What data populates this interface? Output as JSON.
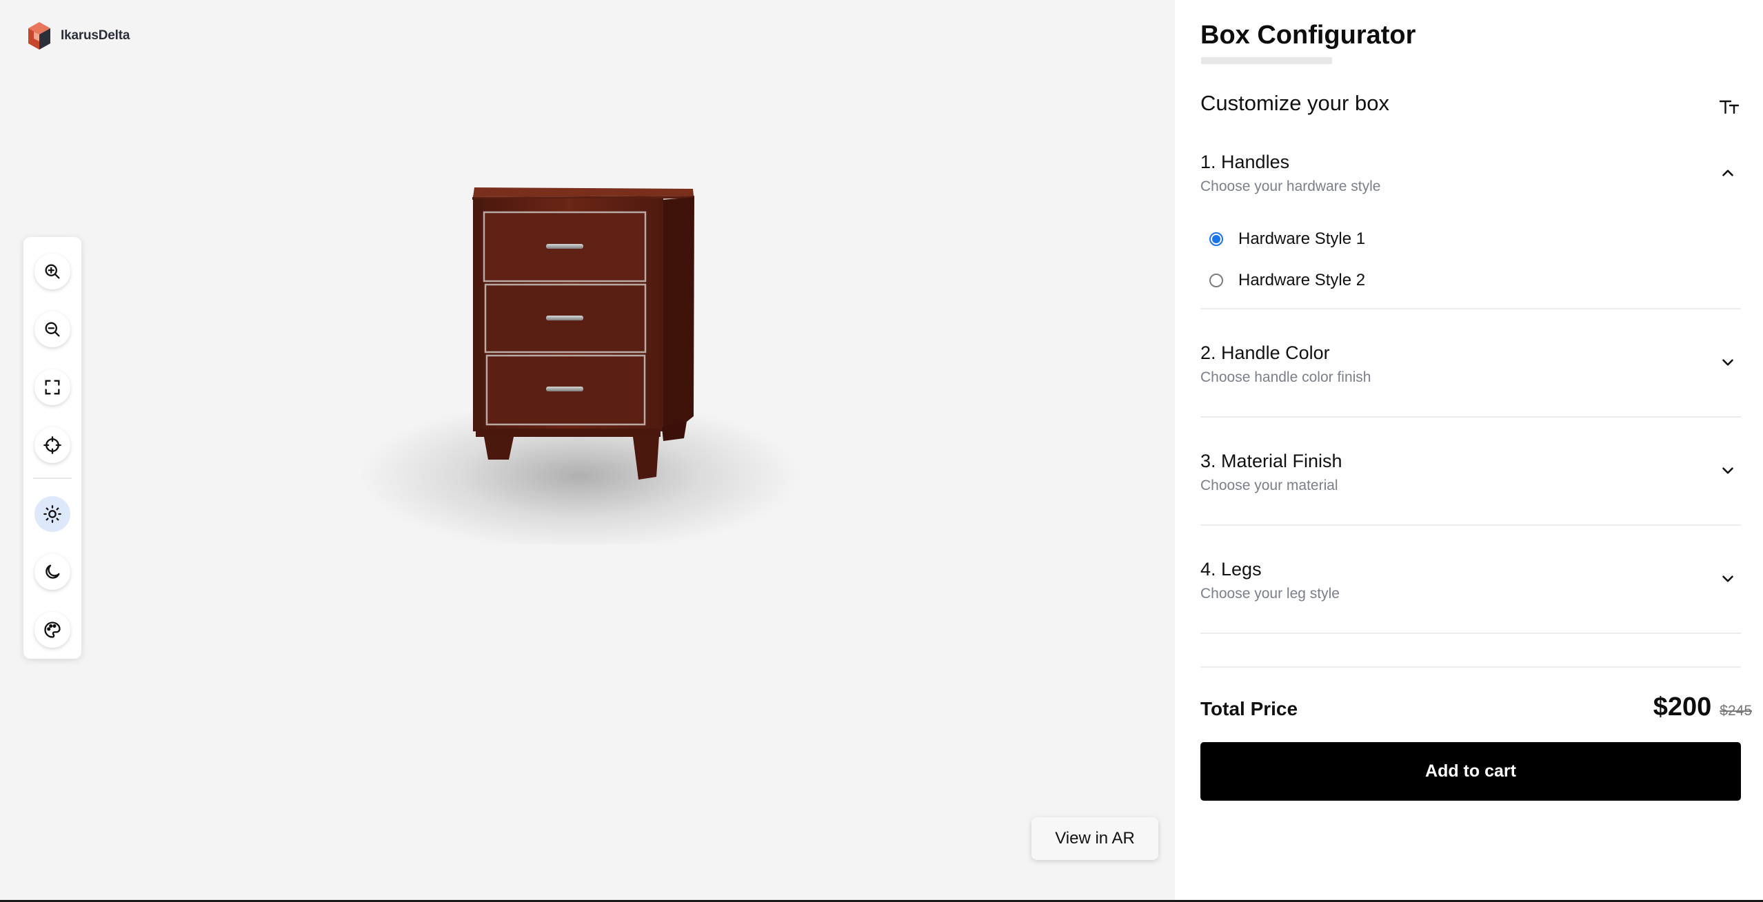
{
  "brand": {
    "name": "IkarusDelta"
  },
  "viewer": {
    "ar_button_label": "View in AR",
    "tools": [
      {
        "icon": "zoom-in-icon"
      },
      {
        "icon": "zoom-out-icon"
      },
      {
        "icon": "fullscreen-icon"
      },
      {
        "icon": "recenter-icon"
      },
      {
        "icon": "light-mode-icon",
        "active": true
      },
      {
        "icon": "dark-mode-icon"
      },
      {
        "icon": "palette-icon"
      }
    ]
  },
  "panel": {
    "title": "Box Configurator",
    "progress_fraction": 0.0,
    "subtitle": "Customize your box",
    "sections": [
      {
        "title": "1. Handles",
        "description": "Choose your hardware style",
        "expanded": true,
        "options": [
          {
            "label": "Hardware Style 1",
            "selected": true
          },
          {
            "label": "Hardware Style 2",
            "selected": false
          }
        ]
      },
      {
        "title": "2. Handle Color",
        "description": "Choose handle color finish",
        "expanded": false
      },
      {
        "title": "3. Material Finish",
        "description": "Choose your material",
        "expanded": false
      },
      {
        "title": "4. Legs",
        "description": "Choose your leg style",
        "expanded": false
      }
    ],
    "total_label": "Total Price",
    "price_current": "$200",
    "price_original": "$245",
    "add_to_cart_label": "Add to cart"
  },
  "colors": {
    "accent": "#1a73e8",
    "active_tool_bg": "#dde9fb",
    "cart_button": "#000000",
    "wood": "#5a1f12"
  }
}
